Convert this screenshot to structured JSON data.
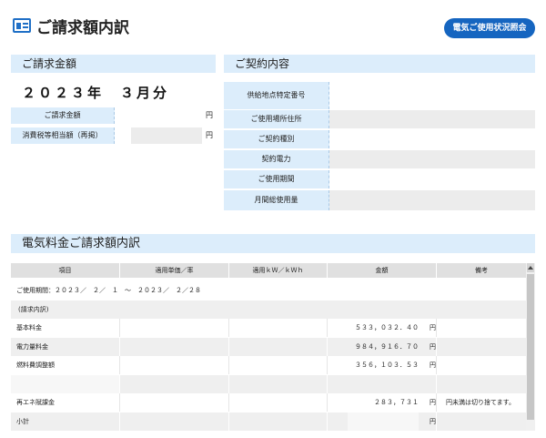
{
  "header": {
    "title": "ご請求額内訳",
    "status_button": "電気ご使用状況照会"
  },
  "billing": {
    "section_title": "ご請求金額",
    "period": "２０２３年　３月分",
    "rows": [
      {
        "label": "ご請求金額",
        "unit": "円"
      },
      {
        "label": "消費税等相当額（再掲）",
        "unit": "円"
      }
    ]
  },
  "contract": {
    "section_title": "ご契約内容",
    "rows": [
      {
        "label": "供給地点特定番号"
      },
      {
        "label": "ご使用場所住所"
      },
      {
        "label": "ご契約種別"
      },
      {
        "label": "契約電力"
      },
      {
        "label": "ご使用期間"
      },
      {
        "label": "月間総使用量"
      }
    ]
  },
  "breakdown": {
    "section_title": "電気料金ご請求額内訳",
    "columns": [
      "項目",
      "適用単価／率",
      "適用ｋＷ／ｋＷｈ",
      "金額",
      "備考"
    ],
    "usage_period": "ご使用期間：２０２３／　２／　１　～　２０２３／　２／２８",
    "group_label": "(請求内訳)",
    "rows": [
      {
        "item": "基本料金",
        "amount": "５３３，０３２．４０",
        "unit": "円",
        "note": ""
      },
      {
        "item": "電力量料金",
        "amount": "９８４，９１６．７０",
        "unit": "円",
        "note": ""
      },
      {
        "item": "燃料費調整額",
        "amount": "３５６，１０３．５３",
        "unit": "円",
        "note": ""
      },
      {
        "item": "",
        "amount": "",
        "unit": "",
        "note": ""
      },
      {
        "item": "再エネ賦課金",
        "amount": "２８３，７３１",
        "unit": "円",
        "note": "円未満は切り捨てます。"
      },
      {
        "item": "小計",
        "amount": "",
        "unit": "円",
        "note": ""
      }
    ]
  }
}
